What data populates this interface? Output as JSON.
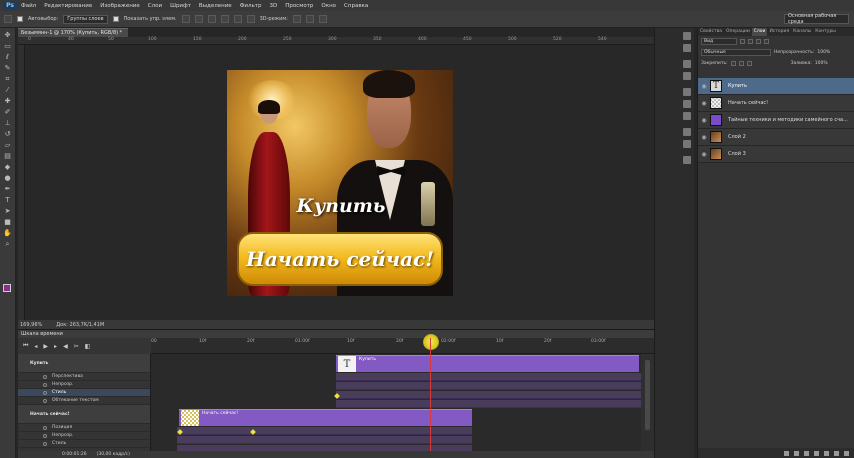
{
  "menu": {
    "logo": "Ps",
    "items": [
      "Файл",
      "Редактирование",
      "Изображение",
      "Слои",
      "Шрифт",
      "Выделение",
      "Фильтр",
      "3D",
      "Просмотр",
      "Окно",
      "Справка"
    ]
  },
  "options": {
    "auto_select_label": "Автовыбор:",
    "auto_select_value": "Группы слоев",
    "show_controls_label": "Показать упр. элем.",
    "mode_3d": "3D-режим:",
    "workspace": "Основная рабочая среда"
  },
  "document": {
    "tab_title": "Безымянн-1 @ 170% (Купить, RGB/8) *",
    "zoom": "169,96%",
    "doc_size": "Док: 263,7K/1,41M",
    "artwork_text_1": "Купить",
    "artwork_button_text": "Начать сейчас!"
  },
  "ruler_top": [
    "0",
    "40",
    "50",
    "100",
    "150",
    "200",
    "250",
    "300",
    "350",
    "400",
    "450",
    "500",
    "520",
    "540"
  ],
  "panels": {
    "tabs": [
      "Свойства",
      "Операции",
      "Слои",
      "История",
      "Каналы",
      "Контуры"
    ],
    "active_tab": "Слои",
    "kind_label": "Вид",
    "blend_mode": "Обычные",
    "opacity_label": "Непрозрачность:",
    "opacity_value": "100%",
    "lock_label": "Закрепить:",
    "fill_label": "Заливка:",
    "fill_value": "100%"
  },
  "layers": [
    {
      "name": "Купить",
      "type": "text",
      "selected": true
    },
    {
      "name": "Начать сейчас!",
      "type": "check",
      "selected": false
    },
    {
      "name": "Тайные техники и методики самейного сча...",
      "type": "purple",
      "selected": false
    },
    {
      "name": "Слой 2",
      "type": "photo",
      "selected": false
    },
    {
      "name": "Слой 3",
      "type": "photo",
      "selected": false
    }
  ],
  "timeline": {
    "title": "Шкала времени",
    "ruler_labels": [
      "00",
      "10f",
      "20f",
      "01:00f",
      "10f",
      "20f",
      "02:00f",
      "10f",
      "20f",
      "03:00f"
    ],
    "current_time": "0:00:01:26",
    "fps": "(30,00 кадр/с)",
    "rows": [
      {
        "kind": "group",
        "label": "Купить"
      },
      {
        "kind": "sub",
        "label": "Перспектива"
      },
      {
        "kind": "sub",
        "label": "Непрозр."
      },
      {
        "kind": "sub",
        "label": "Стиль",
        "active": true
      },
      {
        "kind": "sub",
        "label": "Обтекание текстом"
      },
      {
        "kind": "group",
        "label": "Начать сейчас!"
      },
      {
        "kind": "sub",
        "label": "Позиция"
      },
      {
        "kind": "sub",
        "label": "Непрозр."
      },
      {
        "kind": "sub",
        "label": "Стиль"
      }
    ],
    "clip_1_label": "Купить",
    "clip_2_label": "Начать сейчас!"
  },
  "colors": {
    "foreground": "#8e2e8e",
    "background": "#ffffff",
    "clip": "#8359c4",
    "playhead": "#d63a3a"
  }
}
